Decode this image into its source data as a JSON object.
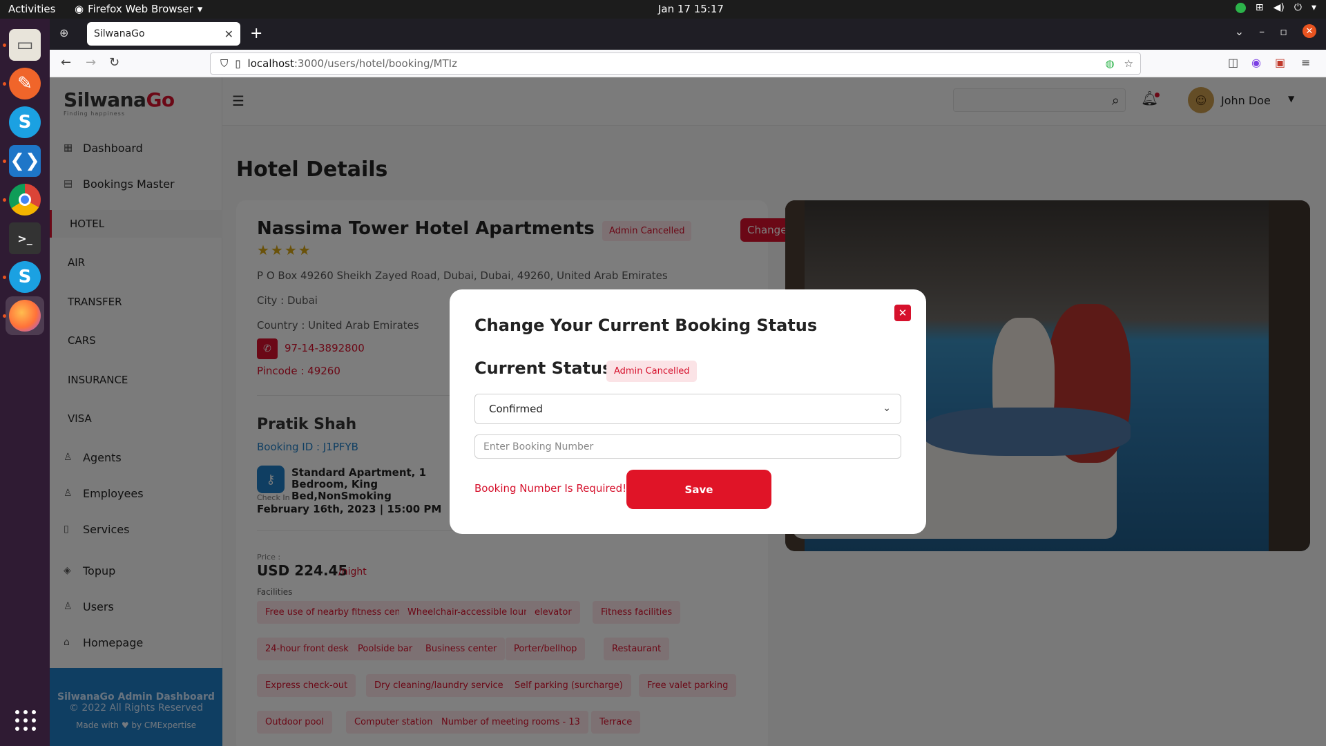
{
  "os": {
    "activities": "Activities",
    "app_name": "Firefox Web Browser",
    "clock": "Jan 17  15:17"
  },
  "browser": {
    "tab_title": "SilwanaGo",
    "url_host": "localhost",
    "url_path": ":3000/users/hotel/booking/MTIz"
  },
  "sidebar": {
    "logo_main": "Silwana",
    "logo_accent": "Go",
    "logo_tag": "Finding happiness",
    "items": [
      {
        "label": "Dashboard"
      },
      {
        "label": "Bookings Master"
      },
      {
        "label": "HOTEL"
      },
      {
        "label": "AIR"
      },
      {
        "label": "TRANSFER"
      },
      {
        "label": "CARS"
      },
      {
        "label": "INSURANCE"
      },
      {
        "label": "VISA"
      },
      {
        "label": "Agents"
      },
      {
        "label": "Employees"
      },
      {
        "label": "Services"
      },
      {
        "label": "Topup"
      },
      {
        "label": "Users"
      },
      {
        "label": "Homepage"
      }
    ],
    "footer_title": "SilwanaGo Admin Dashboard",
    "footer_copy": "© 2022 All Rights Reserved",
    "footer_made": "Made with ♥ by CMExpertise"
  },
  "header": {
    "user_name": "John Doe"
  },
  "page": {
    "title": "Hotel Details"
  },
  "hotel": {
    "name": "Nassima Tower Hotel Apartments",
    "stars": "★★★★",
    "status": "Admin Cancelled",
    "change_label": "Change",
    "address": "P O Box 49260 Sheikh Zayed Road, Dubai, Dubai, 49260, United Arab Emirates",
    "city": "City : Dubai",
    "country": "Country : United Arab Emirates",
    "phone": "97-14-3892800",
    "pincode": "Pincode : 49260",
    "guest_name": "Pratik Shah",
    "booking_id": "Booking ID : J1PFYB",
    "room_type": "Standard Apartment, 1 Bedroom, King Bed,NonSmoking",
    "checkin_label": "Check In",
    "checkin_value": "February 16th, 2023 | 15:00 PM",
    "price_label": "Price :",
    "price_value": "USD 224.45",
    "price_unit": "/night",
    "facilities_label": "Facilities",
    "facilities": [
      "Free use of nearby fitness center",
      "Wheelchair-accessible lounge",
      "elevator",
      "Fitness facilities",
      "24-hour front desk",
      "Poolside bar",
      "Business center",
      "Porter/bellhop",
      "Restaurant",
      "Express check-out",
      "Dry cleaning/laundry service",
      "Self parking (surcharge)",
      "Free valet parking",
      "Outdoor pool",
      "Computer station",
      "Number of meeting rooms - 13",
      "Terrace"
    ]
  },
  "modal": {
    "title": "Change Your Current Booking Status",
    "current_label": "Current Status :",
    "current_value": "Admin Cancelled",
    "selected_status": "Confirmed",
    "booking_placeholder": "Enter Booking Number",
    "error": "Booking Number Is Required!",
    "save_label": "Save"
  },
  "colors": {
    "accent": "#d6112c",
    "link": "#1e7cc4"
  }
}
